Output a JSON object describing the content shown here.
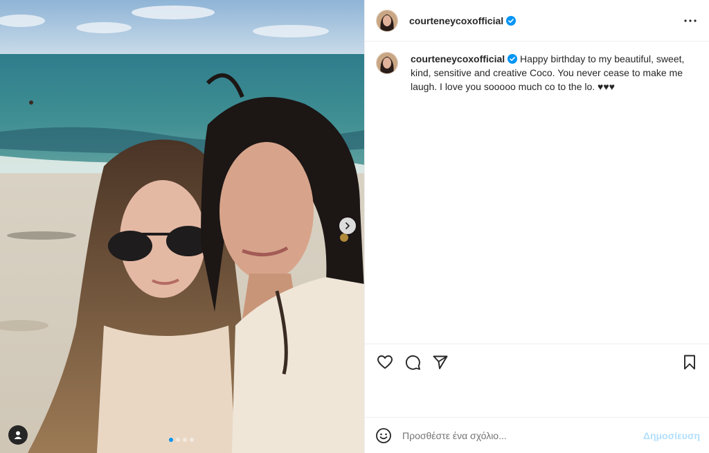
{
  "post": {
    "username": "courteneycoxofficial",
    "caption": "Happy birthday to my beautiful, sweet, kind, sensitive and creative Coco. You never cease to make me laugh. I love you sooooo much co to the lo. ♥♥♥"
  },
  "photo": {
    "slide_count": 4,
    "active_slide": 1
  },
  "comment": {
    "placeholder": "Προσθέστε ένα σχόλιο...",
    "post_label": "Δημοσίευση"
  },
  "icons": {
    "verified": "verified-badge-icon",
    "more": "more-options-icon",
    "like": "heart-icon",
    "comment": "comment-icon",
    "share": "send-icon",
    "save": "bookmark-icon",
    "emoji": "emoji-icon",
    "next": "chevron-right-icon",
    "tag": "user-tag-icon"
  },
  "colors": {
    "verified": "#0095f6",
    "post_button_disabled": "#b2dffc",
    "text": "#262626"
  }
}
